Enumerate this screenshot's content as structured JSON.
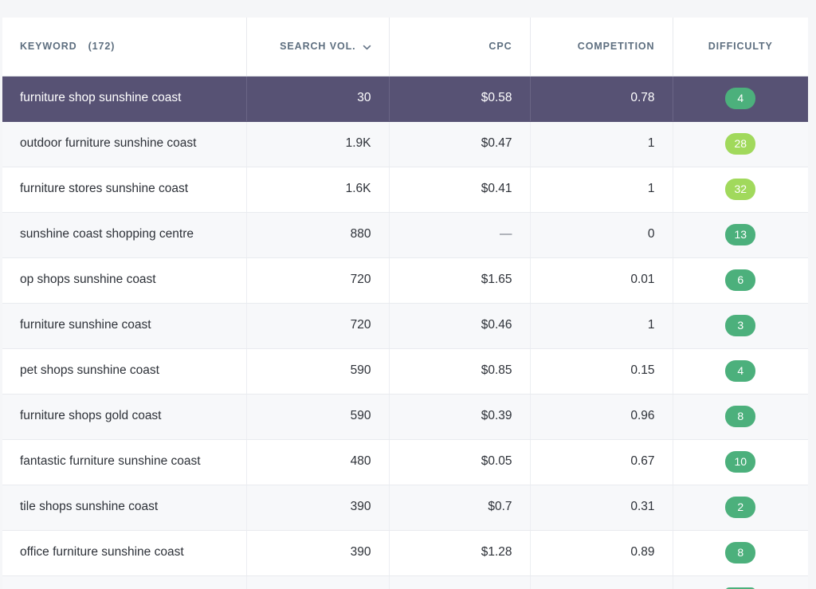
{
  "table": {
    "columns": [
      {
        "key": "keyword",
        "label": "KEYWORD",
        "count": "(172)",
        "align": "left",
        "sortable": true,
        "sorted": false
      },
      {
        "key": "volume",
        "label": "SEARCH VOL.",
        "align": "right",
        "sortable": true,
        "sorted": true,
        "sort_icon": "chevron-down-icon"
      },
      {
        "key": "cpc",
        "label": "CPC",
        "align": "right",
        "sortable": true,
        "sorted": false
      },
      {
        "key": "competition",
        "label": "COMPETITION",
        "align": "right",
        "sortable": true,
        "sorted": false
      },
      {
        "key": "difficulty",
        "label": "DIFFICULTY",
        "align": "center",
        "sortable": true,
        "sorted": false
      }
    ],
    "colors": {
      "active_row_bg": "#575274",
      "badge_green": "#4cb07c",
      "badge_lime": "#a1d95c",
      "header_text": "#5d6e7f",
      "page_bg": "#f5f6f8",
      "row_alt_bg": "#f7f8fa"
    },
    "rows": [
      {
        "keyword": "furniture shop sunshine coast",
        "volume": "30",
        "cpc": "$0.58",
        "competition": "0.78",
        "difficulty": "4",
        "difficulty_color": "#4cb07c",
        "active": true
      },
      {
        "keyword": "outdoor furniture sunshine coast",
        "volume": "1.9K",
        "cpc": "$0.47",
        "competition": "1",
        "difficulty": "28",
        "difficulty_color": "#a1d95c",
        "active": false
      },
      {
        "keyword": "furniture stores sunshine coast",
        "volume": "1.6K",
        "cpc": "$0.41",
        "competition": "1",
        "difficulty": "32",
        "difficulty_color": "#a1d95c",
        "active": false
      },
      {
        "keyword": "sunshine coast shopping centre",
        "volume": "880",
        "cpc": "—",
        "competition": "0",
        "difficulty": "13",
        "difficulty_color": "#4cb07c",
        "active": false
      },
      {
        "keyword": "op shops sunshine coast",
        "volume": "720",
        "cpc": "$1.65",
        "competition": "0.01",
        "difficulty": "6",
        "difficulty_color": "#4cb07c",
        "active": false
      },
      {
        "keyword": "furniture sunshine coast",
        "volume": "720",
        "cpc": "$0.46",
        "competition": "1",
        "difficulty": "3",
        "difficulty_color": "#4cb07c",
        "active": false
      },
      {
        "keyword": "pet shops sunshine coast",
        "volume": "590",
        "cpc": "$0.85",
        "competition": "0.15",
        "difficulty": "4",
        "difficulty_color": "#4cb07c",
        "active": false
      },
      {
        "keyword": "furniture shops gold coast",
        "volume": "590",
        "cpc": "$0.39",
        "competition": "0.96",
        "difficulty": "8",
        "difficulty_color": "#4cb07c",
        "active": false
      },
      {
        "keyword": "fantastic furniture sunshine coast",
        "volume": "480",
        "cpc": "$0.05",
        "competition": "0.67",
        "difficulty": "10",
        "difficulty_color": "#4cb07c",
        "active": false
      },
      {
        "keyword": "tile shops sunshine coast",
        "volume": "390",
        "cpc": "$0.7",
        "competition": "0.31",
        "difficulty": "2",
        "difficulty_color": "#4cb07c",
        "active": false
      },
      {
        "keyword": "office furniture sunshine coast",
        "volume": "390",
        "cpc": "$1.28",
        "competition": "0.89",
        "difficulty": "8",
        "difficulty_color": "#4cb07c",
        "active": false
      },
      {
        "keyword": "",
        "volume": "",
        "cpc": "",
        "competition": "",
        "difficulty": "",
        "difficulty_color": "#4cb07c",
        "active": false,
        "partial": true
      }
    ]
  }
}
